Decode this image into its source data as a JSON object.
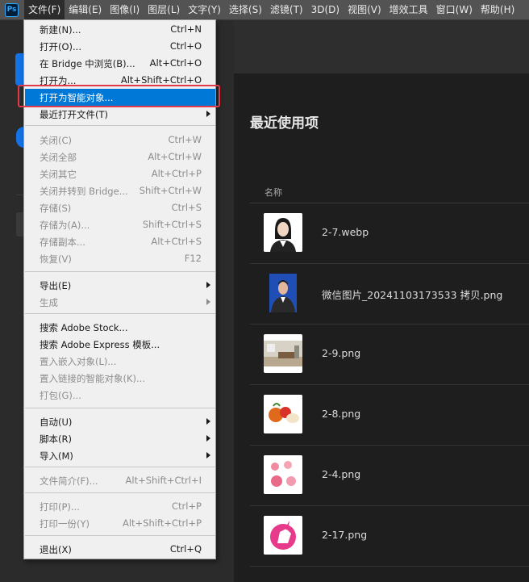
{
  "menubar": {
    "logo": "Ps",
    "items": [
      "文件(F)",
      "编辑(E)",
      "图像(I)",
      "图层(L)",
      "文字(Y)",
      "选择(S)",
      "滤镜(T)",
      "3D(D)",
      "视图(V)",
      "增效工具",
      "窗口(W)",
      "帮助(H)"
    ]
  },
  "home": {
    "recent_title": "最近使用项",
    "column_name": "名称",
    "files": [
      {
        "name": "2-7.webp",
        "thumb": "portrait-icon"
      },
      {
        "name": "微信图片_20241103173533 拷贝.png",
        "thumb": "portrait-blue-icon"
      },
      {
        "name": "2-9.png",
        "thumb": "room-icon"
      },
      {
        "name": "2-8.png",
        "thumb": "fruit-icon"
      },
      {
        "name": "2-4.png",
        "thumb": "flowers-icon"
      },
      {
        "name": "2-17.png",
        "thumb": "unicorn-icon"
      }
    ]
  },
  "menu": {
    "items": [
      {
        "label": "新建(N)...",
        "shortcut": "Ctrl+N"
      },
      {
        "label": "打开(O)...",
        "shortcut": "Ctrl+O"
      },
      {
        "label": "在 Bridge 中浏览(B)...",
        "shortcut": "Alt+Ctrl+O"
      },
      {
        "label": "打开为...",
        "shortcut": "Alt+Shift+Ctrl+O"
      },
      {
        "label": "打开为智能对象...",
        "shortcut": ""
      },
      {
        "label": "最近打开文件(T)",
        "shortcut": ""
      },
      {
        "label": "关闭(C)",
        "shortcut": "Ctrl+W"
      },
      {
        "label": "关闭全部",
        "shortcut": "Alt+Ctrl+W"
      },
      {
        "label": "关闭其它",
        "shortcut": "Alt+Ctrl+P"
      },
      {
        "label": "关闭并转到 Bridge...",
        "shortcut": "Shift+Ctrl+W"
      },
      {
        "label": "存储(S)",
        "shortcut": "Ctrl+S"
      },
      {
        "label": "存储为(A)...",
        "shortcut": "Shift+Ctrl+S"
      },
      {
        "label": "存储副本...",
        "shortcut": "Alt+Ctrl+S"
      },
      {
        "label": "恢复(V)",
        "shortcut": "F12"
      },
      {
        "label": "导出(E)",
        "shortcut": ""
      },
      {
        "label": "生成",
        "shortcut": ""
      },
      {
        "label": "搜索 Adobe Stock...",
        "shortcut": ""
      },
      {
        "label": "搜索 Adobe Express 模板...",
        "shortcut": ""
      },
      {
        "label": "置入嵌入对象(L)...",
        "shortcut": ""
      },
      {
        "label": "置入链接的智能对象(K)...",
        "shortcut": ""
      },
      {
        "label": "打包(G)...",
        "shortcut": ""
      },
      {
        "label": "自动(U)",
        "shortcut": ""
      },
      {
        "label": "脚本(R)",
        "shortcut": ""
      },
      {
        "label": "导入(M)",
        "shortcut": ""
      },
      {
        "label": "文件简介(F)...",
        "shortcut": "Alt+Shift+Ctrl+I"
      },
      {
        "label": "打印(P)...",
        "shortcut": "Ctrl+P"
      },
      {
        "label": "打印一份(Y)",
        "shortcut": "Alt+Shift+Ctrl+P"
      },
      {
        "label": "退出(X)",
        "shortcut": "Ctrl+Q"
      }
    ]
  }
}
